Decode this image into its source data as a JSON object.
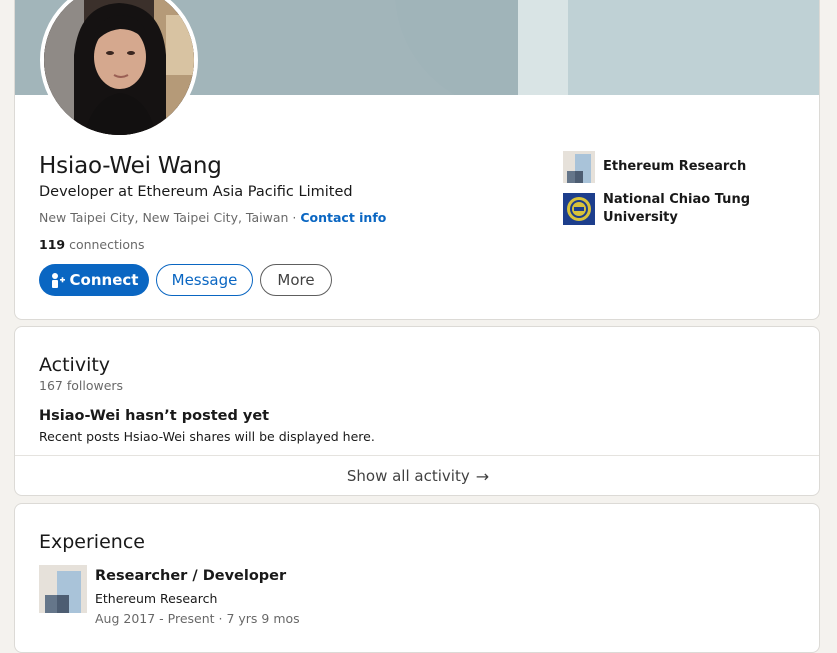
{
  "profile": {
    "name": "Hsiao-Wei Wang",
    "headline": "Developer at Ethereum Asia Pacific Limited",
    "location": "New Taipei City, New Taipei City, Taiwan",
    "separator": " · ",
    "contact_link": "Contact info",
    "connections_count": "119",
    "connections_label": " connections",
    "buttons": {
      "connect": "Connect",
      "message": "Message",
      "more": "More"
    },
    "organizations": [
      {
        "name": "Ethereum Research",
        "logo_icon": "ethereum-research-logo"
      },
      {
        "name": "National Chiao Tung University",
        "logo_icon": "nctu-seal-logo"
      }
    ]
  },
  "activity": {
    "title": "Activity",
    "followers": "167 followers",
    "empty_title": "Hsiao-Wei hasn’t posted yet",
    "empty_desc": "Recent posts Hsiao-Wei shares will be displayed here.",
    "show_all": "Show all activity",
    "arrow": "→"
  },
  "experience": {
    "title": "Experience",
    "items": [
      {
        "role": "Researcher / Developer",
        "company": "Ethereum Research",
        "dates": "Aug 2017 - Present · 7 yrs 9 mos"
      }
    ]
  },
  "colors": {
    "accent": "#0a66c2",
    "page_bg": "#f4f2ee",
    "banner": "#a2b5ba"
  }
}
